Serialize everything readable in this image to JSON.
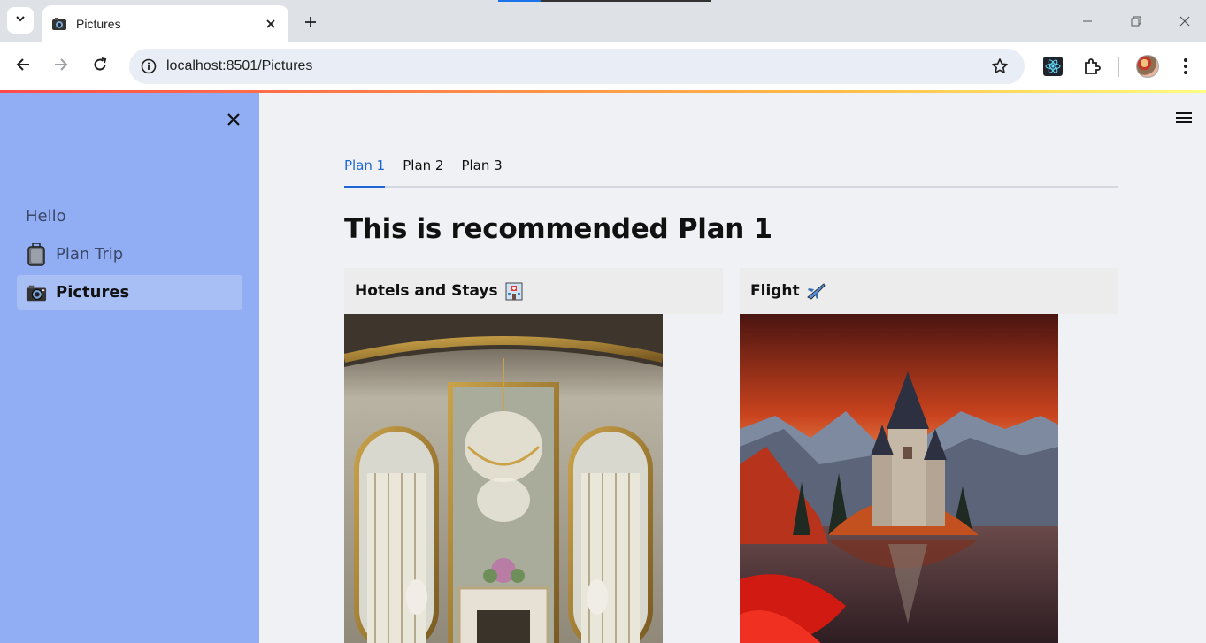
{
  "browser": {
    "tab_title": "Pictures",
    "url": "localhost:8501/Pictures"
  },
  "sidebar": {
    "items": [
      {
        "label": "Hello",
        "icon": "",
        "active": false
      },
      {
        "label": "Plan Trip",
        "icon": "luggage-icon",
        "active": false
      },
      {
        "label": "Pictures",
        "icon": "camera-icon",
        "active": true
      }
    ]
  },
  "main": {
    "tabs": [
      {
        "label": "Plan 1",
        "active": true
      },
      {
        "label": "Plan 2",
        "active": false
      },
      {
        "label": "Plan 3",
        "active": false
      }
    ],
    "heading": "This is recommended Plan 1",
    "cards": [
      {
        "title": "Hotels and Stays",
        "emoji_icon": "hotel-icon",
        "image": "ornate-palace-interior-chandelier"
      },
      {
        "title": "Flight",
        "emoji_icon": "airplane-icon",
        "image": "castle-on-lake-sunset"
      }
    ]
  },
  "colors": {
    "sidebar_bg": "#91aef4",
    "app_bg": "#eff1f5",
    "tab_active": "#1f66d2"
  }
}
